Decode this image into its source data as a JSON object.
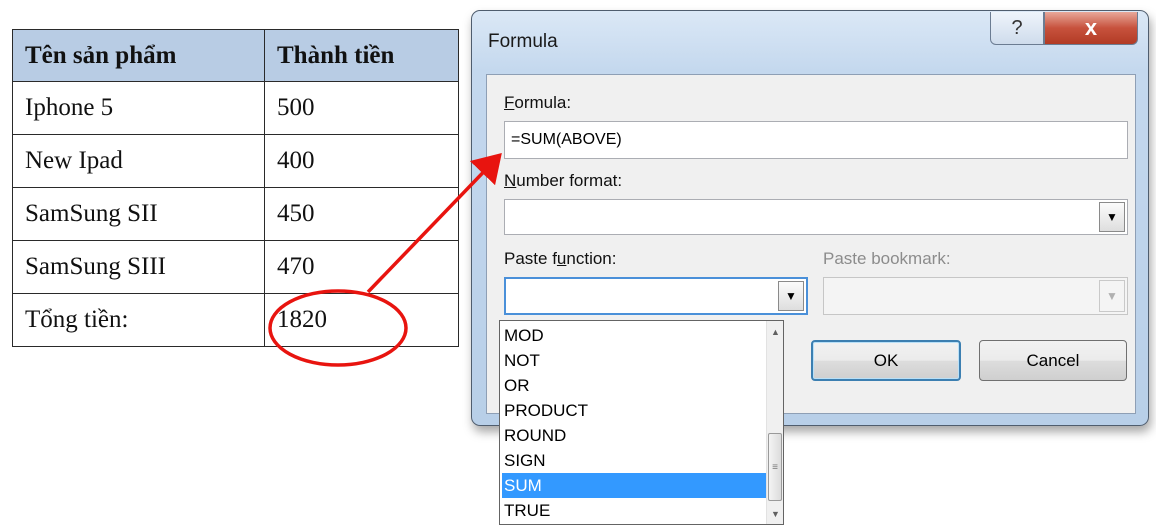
{
  "table": {
    "headers": [
      "Tên sản phẩm",
      "Thành tiền"
    ],
    "rows": [
      [
        "Iphone 5",
        "500"
      ],
      [
        "New Ipad",
        "400"
      ],
      [
        "SamSung SII",
        "450"
      ],
      [
        "SamSung SIII",
        "470"
      ],
      [
        "Tổng tiền:",
        "1820"
      ]
    ],
    "header_bg": "#b8cce4"
  },
  "dialog": {
    "title": "Formula",
    "help_glyph": "?",
    "close_glyph": "x",
    "formula": {
      "label_key": "F",
      "label_rest": "ormula:",
      "value": "=SUM(ABOVE)"
    },
    "number_format": {
      "label_key": "N",
      "label_rest": "umber format:",
      "value": ""
    },
    "paste_function": {
      "label_pre": "Paste f",
      "label_key": "u",
      "label_post": "nction:",
      "value": "",
      "options": [
        "MOD",
        "NOT",
        "OR",
        "PRODUCT",
        "ROUND",
        "SIGN",
        "SUM",
        "TRUE"
      ],
      "selected": "SUM"
    },
    "paste_bookmark": {
      "label": "Paste bookmark:",
      "value": "",
      "enabled": false
    },
    "ok_label": "OK",
    "cancel_label": "Cancel"
  },
  "colors": {
    "annotation": "#e8140f",
    "selection": "#3399ff",
    "dialog_frame": "#c4d8ee"
  }
}
